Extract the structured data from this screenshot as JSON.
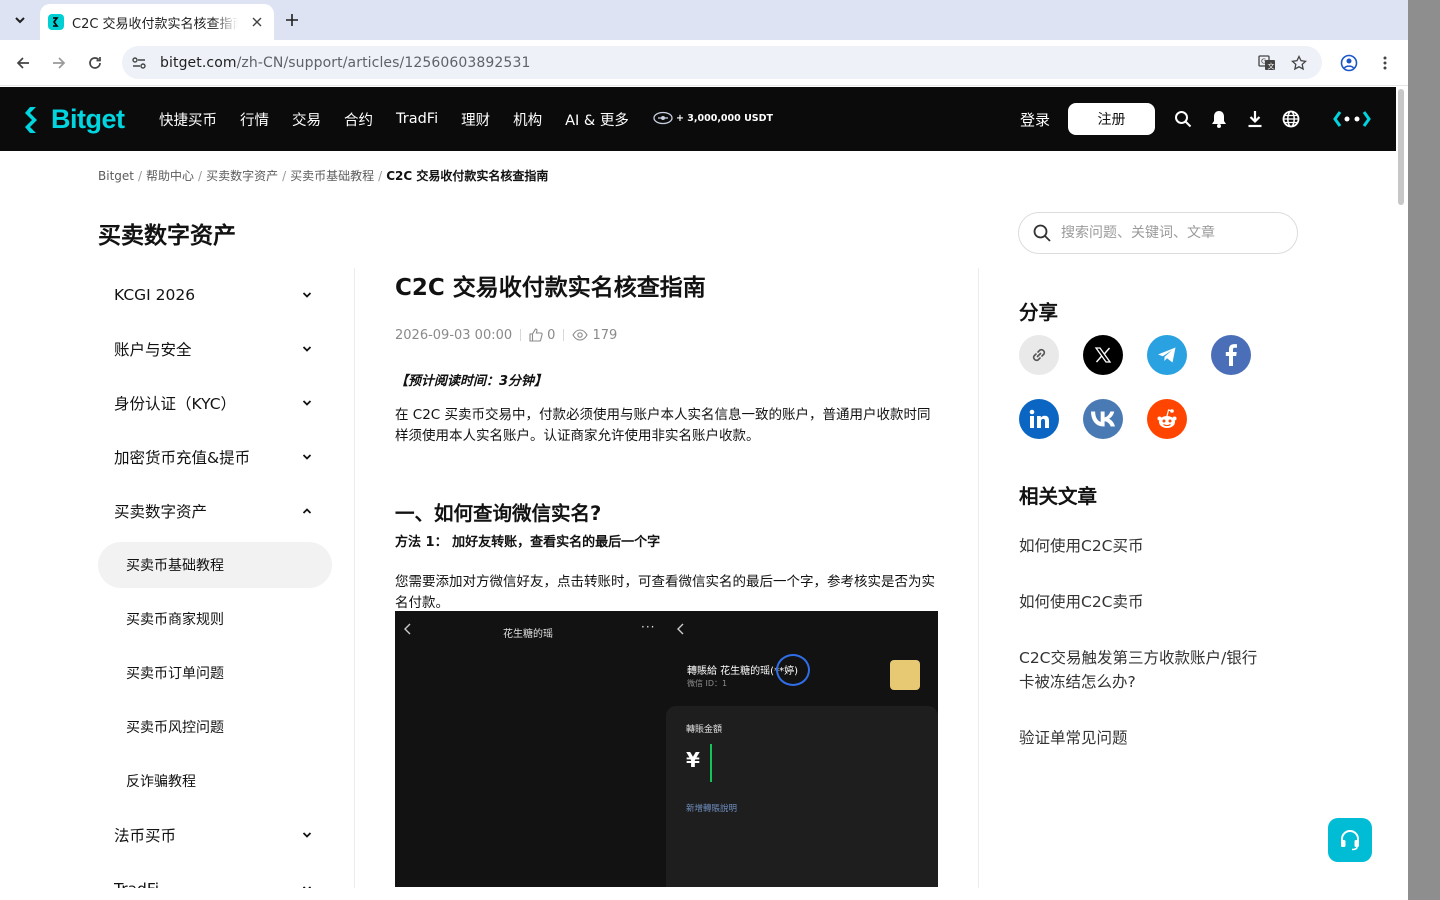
{
  "browser": {
    "tab_title": "C2C 交易收付款实名核查指南",
    "url_host": "bitget.com",
    "url_path": "/zh-CN/support/articles/12560603892531"
  },
  "header": {
    "logo_text": "Bitget",
    "nav": [
      "快捷买币",
      "行情",
      "交易",
      "合约",
      "TradFi",
      "理财",
      "机构",
      "AI & 更多"
    ],
    "promo_text": "+ 3,000,000 USDT",
    "login": "登录",
    "register": "注册",
    "brand_color": "#00d5e0"
  },
  "breadcrumb": [
    "Bitget",
    "帮助中心",
    "买卖数字资产",
    "买卖币基础教程",
    "C2C 交易收付款实名核查指南"
  ],
  "section_title": "买卖数字资产",
  "search": {
    "placeholder": "搜索问题、关键词、文章"
  },
  "sidebar": {
    "items": [
      {
        "label": "KCGI 2026",
        "expanded": false
      },
      {
        "label": "账户与安全",
        "expanded": false
      },
      {
        "label": "身份认证（KYC）",
        "expanded": false
      },
      {
        "label": "加密货币充值&提币",
        "expanded": false
      },
      {
        "label": "买卖数字资产",
        "expanded": true
      },
      {
        "label": "法币买币",
        "expanded": false
      },
      {
        "label": "TradFi",
        "expanded": false
      }
    ],
    "sub_items": [
      "买卖币基础教程",
      "买卖币商家规则",
      "买卖币订单问题",
      "买卖币风控问题",
      "反诈骗教程"
    ],
    "active_sub": "买卖币基础教程"
  },
  "article": {
    "title": "C2C 交易收付款实名核查指南",
    "date": "2026-09-03 00:00",
    "likes": "0",
    "views": "179",
    "read_time": "【预计阅读时间：3分钟】",
    "intro": "在 C2C 买卖币交易中，付款必须使用与账户本人实名信息一致的账户，普通用户收款时同样须使用本人实名账户。认证商家允许使用非实名账户收款。",
    "h2_1": "一、如何查询微信实名?",
    "method_1": "方法 1： 加好友转账，查看实名的最后一个字",
    "para_1": "您需要添加对方微信好友，点击转账时，可查看微信实名的最后一个字，参考核实是否为实名付款。",
    "screenshot": {
      "left_title": "花生糖的瑶",
      "transfer_to": "轉賬給 花生糖的瑶(**婷)",
      "wechat_id": "微信 ID：1",
      "amount_label": "轉賬金額",
      "currency": "¥",
      "add_note": "新增轉賬說明"
    }
  },
  "share": {
    "title": "分享",
    "buttons": [
      {
        "name": "link",
        "bg": "#e9e9e9"
      },
      {
        "name": "x",
        "bg": "#000000"
      },
      {
        "name": "telegram",
        "bg": "#2aa1e0"
      },
      {
        "name": "facebook",
        "bg": "#4a6fb8"
      },
      {
        "name": "linkedin",
        "bg": "#0a66c2"
      },
      {
        "name": "vk",
        "bg": "#4a7ab3"
      },
      {
        "name": "reddit",
        "bg": "#ff4500"
      }
    ]
  },
  "related": {
    "title": "相关文章",
    "links": [
      "如何使用C2C买币",
      "如何使用C2C卖币",
      "C2C交易触发第三方收款账户/银行卡被冻结怎么办?",
      "验证单常见问题"
    ]
  }
}
